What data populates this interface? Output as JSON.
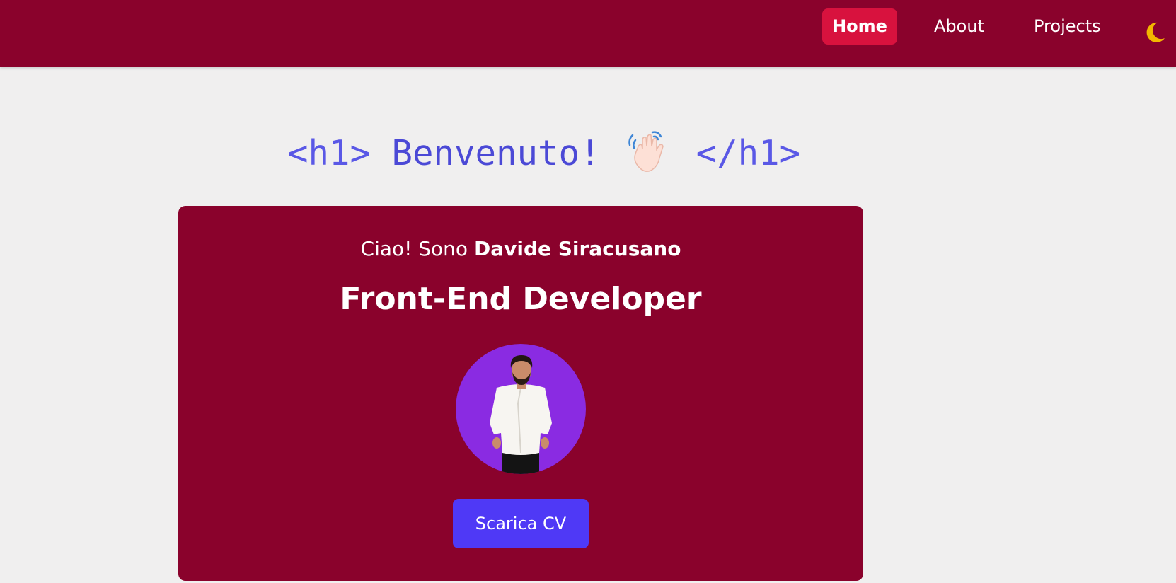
{
  "nav": {
    "items": [
      {
        "label": "Home",
        "active": true
      },
      {
        "label": "About",
        "active": false
      },
      {
        "label": "Projects",
        "active": false
      }
    ],
    "theme_icon": "moon-icon",
    "bg_color": "#8a022c",
    "active_color": "#d8123e",
    "moon_color": "#f2b600"
  },
  "hero": {
    "open_tag": "<h1>",
    "title": "Benvenuto!",
    "close_tag": "</h1>",
    "title_icon": "waving-hand-icon",
    "title_color": "#4b49d6"
  },
  "card": {
    "greeting": "Ciao! Sono",
    "name": "Davide Siracusano",
    "role": "Front-End Developer",
    "avatar_bg": "#8a2be2",
    "button_label": "Scarica CV",
    "button_color": "#4f39f6"
  }
}
